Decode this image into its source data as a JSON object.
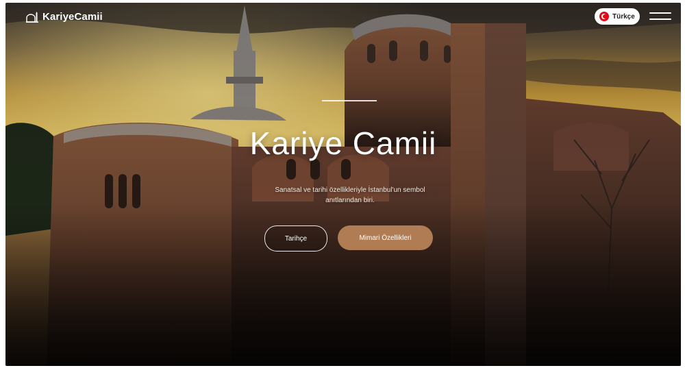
{
  "header": {
    "logo_text": "KariyeCamii",
    "language_label": "Türkçe"
  },
  "hero": {
    "title": "Kariye Camii",
    "subtitle": "Sanatsal ve tarihi özellikleriyle İstanbul'un sembol anıtlarından biri.",
    "buttons": {
      "history": "Tarihçe",
      "architecture": "Mimari Özellikleri"
    }
  },
  "colors": {
    "accent_button": "#b07c54",
    "flag_red": "#e30a17"
  },
  "icons": [
    "mosque-logo-icon",
    "turkish-flag-icon",
    "hamburger-menu-icon"
  ]
}
